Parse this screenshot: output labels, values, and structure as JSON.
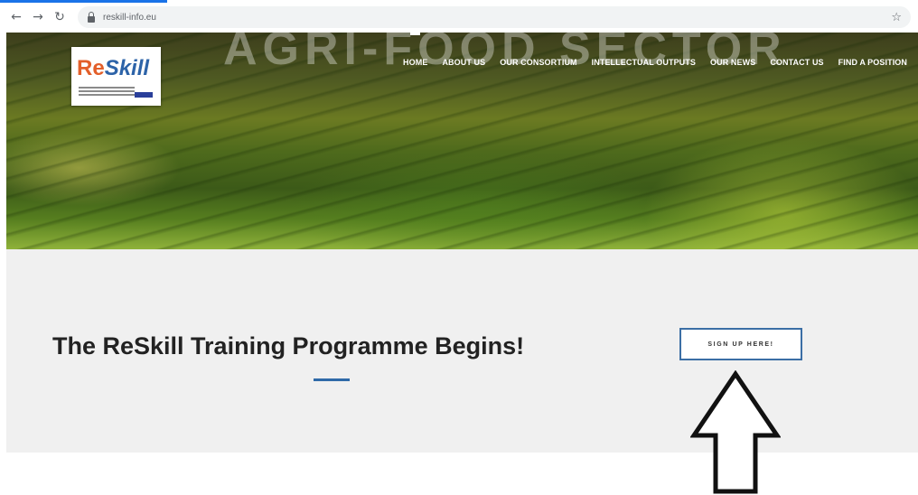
{
  "browser": {
    "back_icon": "arrow-left-icon",
    "forward_icon": "arrow-right-icon",
    "reload_icon": "reload-icon",
    "url": "reskill-info.eu",
    "bookmark_icon": "star-icon"
  },
  "hero": {
    "background_word": "AGRI-FOOD SECTOR",
    "logo": {
      "text_re": "Re",
      "text_skill": "Skill"
    },
    "nav": [
      {
        "label": "HOME",
        "active": true
      },
      {
        "label": "ABOUT US"
      },
      {
        "label": "OUR CONSORTIUM"
      },
      {
        "label": "INTELLECTUAL OUTPUTS"
      },
      {
        "label": "OUR NEWS"
      },
      {
        "label": "CONTACT US"
      },
      {
        "label": "FIND A POSITION"
      }
    ]
  },
  "main": {
    "headline": "The ReSkill Training Programme Begins!",
    "signup_label": "SIGN UP HERE!"
  },
  "colors": {
    "accent": "#2f6aa8",
    "button_border": "#3b6ea5",
    "band": "#f0f0f0"
  },
  "annotation": {
    "icon": "arrow-up-icon"
  }
}
